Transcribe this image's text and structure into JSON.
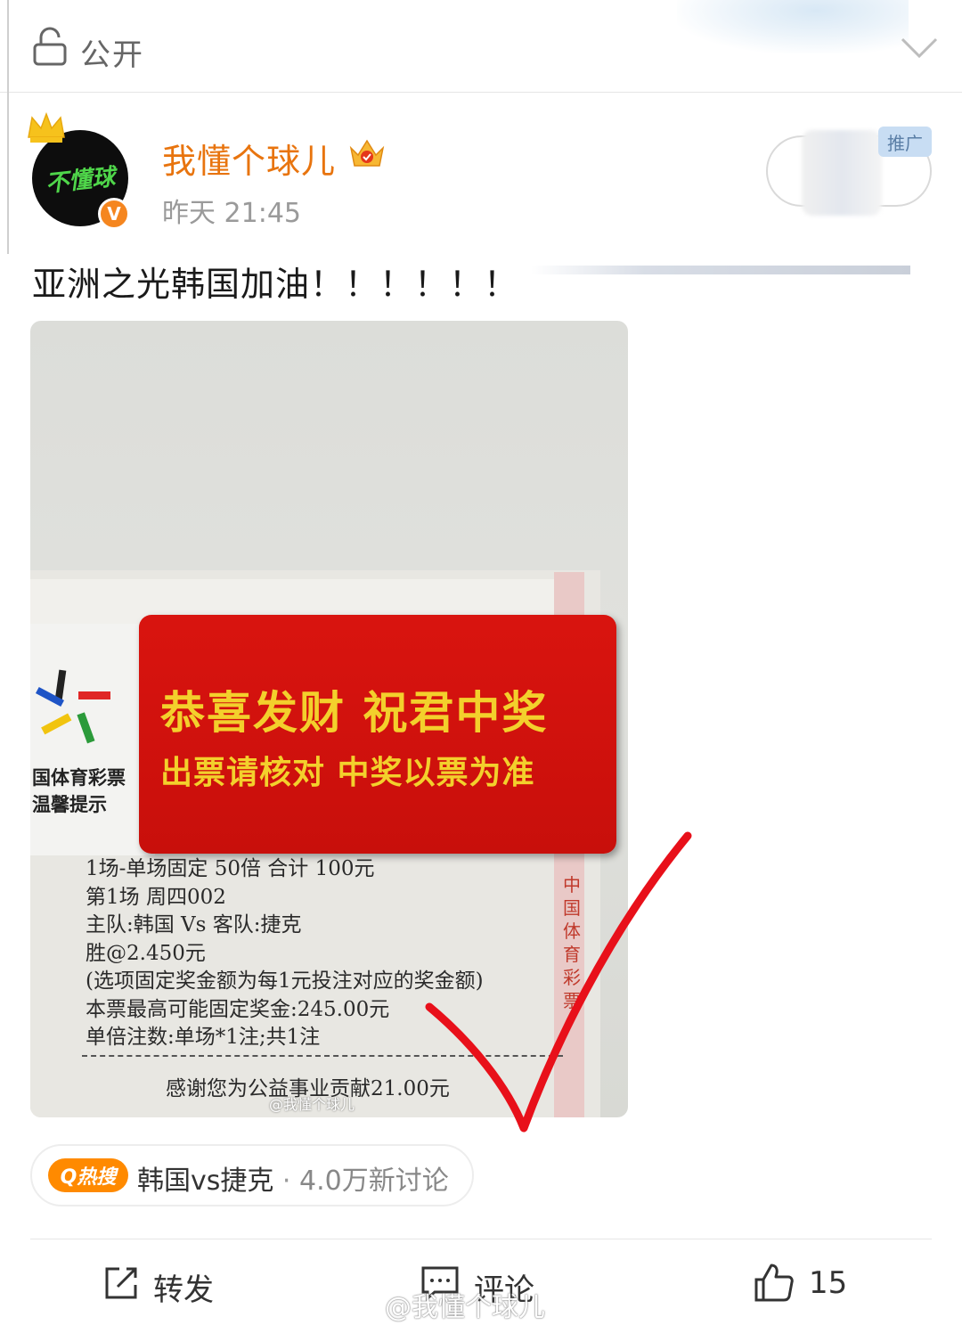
{
  "header": {
    "visibility_label": "公开",
    "lock_icon": "lock-icon",
    "expand_icon": "chevron-down-icon"
  },
  "post": {
    "avatar_text": "不懂球",
    "username": "我懂个球儿",
    "time": "昨天 21:45",
    "verified_badge": "V",
    "ad_badge": "推广",
    "text": "亚洲之光韩国加油！！！！！！",
    "username_color": "#e8740e"
  },
  "image": {
    "card_title_1": "国体育彩票",
    "card_title_2": "温馨提示",
    "panel_line1": "恭喜发财  祝君中奖",
    "panel_line2": "出票请核对  中奖以票为准",
    "strip_text": "中国体育彩票",
    "receipt_lines": [
      "1场-单场固定          50倍      合计  100元",
      "第1场   周四002",
      "主队:韩国  Vs  客队:捷克",
      "胜@2.450元",
      "(选项固定奖金额为每1元投注对应的奖金额)",
      "本票最高可能固定奖金:245.00元",
      "单倍注数:单场*1注;共1注"
    ],
    "thanks_line": "感谢您为公益事业贡献21.00元",
    "watermark": "@我懂个球儿",
    "check_color": "#e8101a"
  },
  "hot_search": {
    "badge": "Q热搜",
    "topic": "韩国vs捷克",
    "separator": " · ",
    "count": "4.0万新讨论"
  },
  "actions": {
    "repost_label": "转发",
    "comment_label": "评论",
    "like_count": "15"
  },
  "watermark_bottom": "@我懂个球儿"
}
